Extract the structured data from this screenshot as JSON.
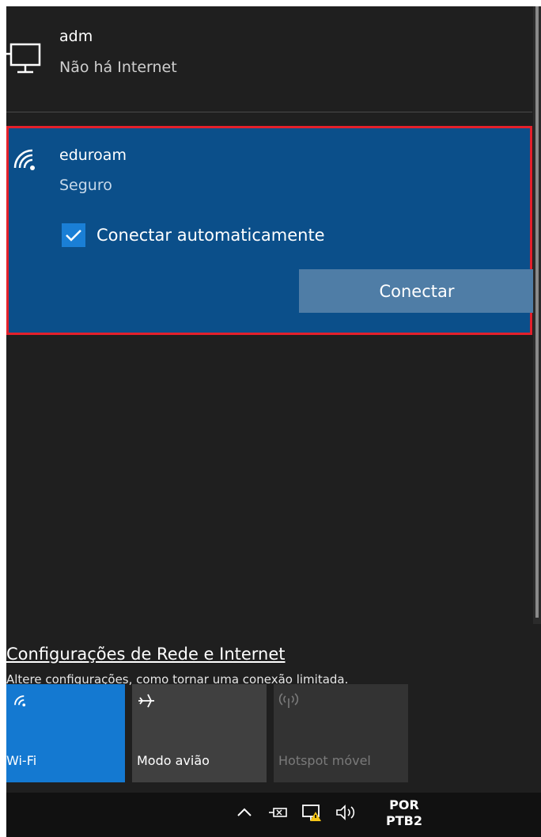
{
  "networks": [
    {
      "name": "adm",
      "status": "Não há Internet",
      "icon": "wired-network-icon"
    },
    {
      "name": "eduroam",
      "status": "Seguro",
      "icon": "wifi-icon"
    }
  ],
  "autoconnect": {
    "label": "Conectar automaticamente",
    "checked": true
  },
  "connect_button": {
    "label": "Conectar"
  },
  "settings": {
    "link": "Configurações de Rede e Internet",
    "description": "Altere configurações, como tornar uma conexão limitada."
  },
  "quick_actions": [
    {
      "label": "Wi-Fi",
      "icon": "wifi-icon",
      "active": true
    },
    {
      "label": "Modo avião",
      "icon": "airplane-icon",
      "active": false
    },
    {
      "label": "Hotspot móvel",
      "icon": "hotspot-icon",
      "active": false,
      "disabled": true
    }
  ],
  "taskbar": {
    "language": "POR",
    "keyboard": "PTB2",
    "icons": [
      "chevron-up-icon",
      "power-icon",
      "network-warning-icon",
      "volume-icon"
    ]
  },
  "colors": {
    "panel_bg": "#1f1f1f",
    "selected_bg": "#0b4f8a",
    "accent": "#1479d1",
    "highlight_border": "#e3202b"
  }
}
